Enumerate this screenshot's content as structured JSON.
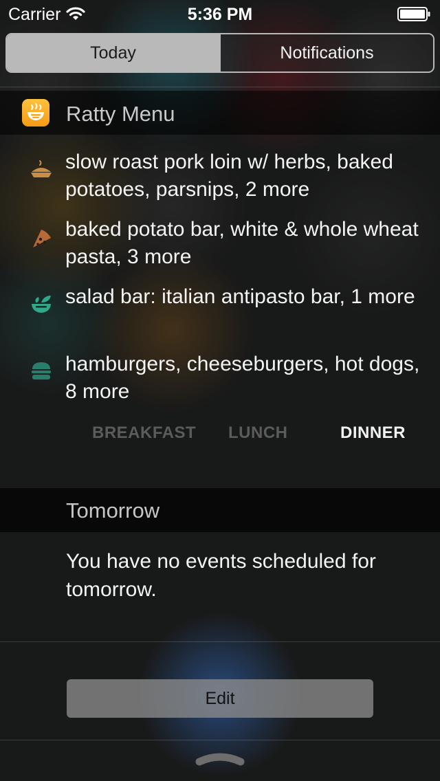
{
  "status_bar": {
    "carrier": "Carrier",
    "time": "5:36 PM"
  },
  "segmented": {
    "today": "Today",
    "notifications": "Notifications",
    "selected": "Today"
  },
  "widget": {
    "title": "Ratty Menu",
    "icon": "food-bowl-icon",
    "items": [
      {
        "icon": "pie-icon",
        "icon_color": "#c98d4a",
        "text": "slow roast pork loin w/ herbs, baked potatoes, parsnips, 2 more"
      },
      {
        "icon": "pizza-slice-icon",
        "icon_color": "#b86a36",
        "text": "baked potato bar, white & whole wheat pasta, 3 more"
      },
      {
        "icon": "salad-bowl-icon",
        "icon_color": "#2fa98a",
        "text": "salad bar: italian antipasto bar, 1 more"
      },
      {
        "icon": "burger-icon",
        "icon_color": "#2a7d6a",
        "text": "hamburgers, cheeseburgers, hot dogs, 8 more"
      }
    ],
    "meal_tabs": {
      "breakfast": "BREAKFAST",
      "lunch": "LUNCH",
      "dinner": "DINNER",
      "selected": "DINNER"
    }
  },
  "tomorrow": {
    "title": "Tomorrow",
    "message": "You have no events scheduled for tomorrow."
  },
  "edit_button": {
    "label": "Edit"
  },
  "colors": {
    "app_icon_top": "#ffc23d",
    "app_icon_bottom": "#f59b16",
    "segment_active": "#b9b9b9",
    "edit_button_glow": "#3c82e6"
  }
}
